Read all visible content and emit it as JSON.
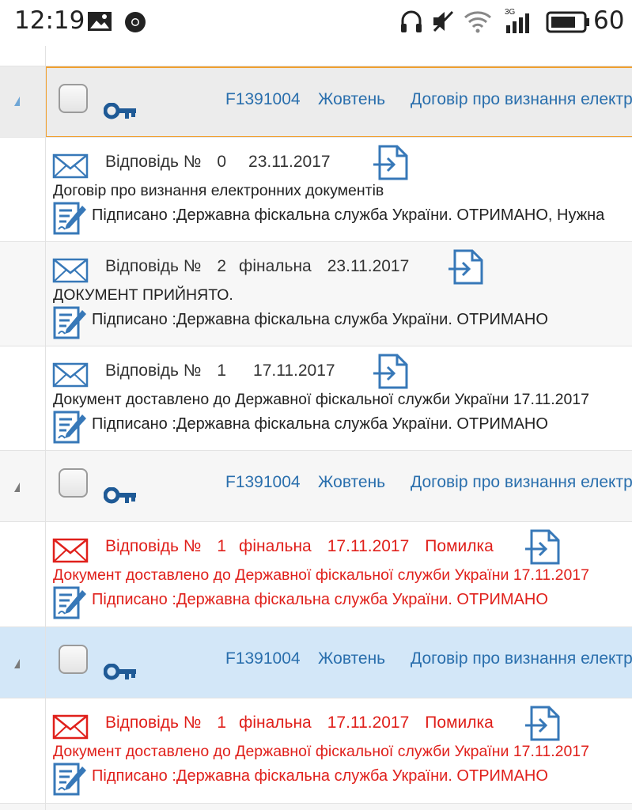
{
  "status_bar": {
    "time": "12:19",
    "battery": "60",
    "network": "3G"
  },
  "groups": [
    {
      "code": "F1391004",
      "month": "Жовтень",
      "title": "Договір про визнання електронних документів",
      "state": "active",
      "responses": [
        {
          "label": "Відповідь №",
          "number": "0",
          "final": "",
          "date": "23.11.2017",
          "error": "",
          "message": "Договір про визнання електронних документів",
          "signed": "Підписано :Державна фіскальна служба України. ОТРИМАНО, Нужна"
        },
        {
          "label": "Відповідь №",
          "number": "2",
          "final": "фінальна",
          "date": "23.11.2017",
          "error": "",
          "message": "ДОКУМЕНТ ПРИЙНЯТО.",
          "signed": "Підписано :Державна фіскальна служба України. ОТРИМАНО"
        },
        {
          "label": "Відповідь №",
          "number": "1",
          "final": "",
          "date": "17.11.2017",
          "error": "",
          "message": "Документ доставлено до Державної фіскальної служби України 17.11.2017",
          "signed": "Підписано :Державна фіскальна служба України. ОТРИМАНО"
        }
      ]
    },
    {
      "code": "F1391004",
      "month": "Жовтень",
      "title": "Договір про визнання електронних документів",
      "state": "normal",
      "responses": [
        {
          "label": "Відповідь №",
          "number": "1",
          "final": "фінальна",
          "date": "17.11.2017",
          "error": "Помилка",
          "message": "Документ доставлено до Державної фіскальної служби України 17.11.2017",
          "signed": "Підписано :Державна фіскальна служба України. ОТРИМАНО"
        }
      ]
    },
    {
      "code": "F1391004",
      "month": "Жовтень",
      "title": "Договір про визнання електронних документів",
      "state": "selected",
      "responses": [
        {
          "label": "Відповідь №",
          "number": "1",
          "final": "фінальна",
          "date": "17.11.2017",
          "error": "Помилка",
          "message": "Документ доставлено до Державної фіскальної служби України 17.11.2017",
          "signed": "Підписано :Державна фіскальна служба України. ОТРИМАНО"
        }
      ]
    }
  ],
  "colors": {
    "link_blue": "#2a6fad",
    "error_red": "#e0201b",
    "active_border": "#f0a030",
    "selected_bg": "#d3e7f8"
  }
}
